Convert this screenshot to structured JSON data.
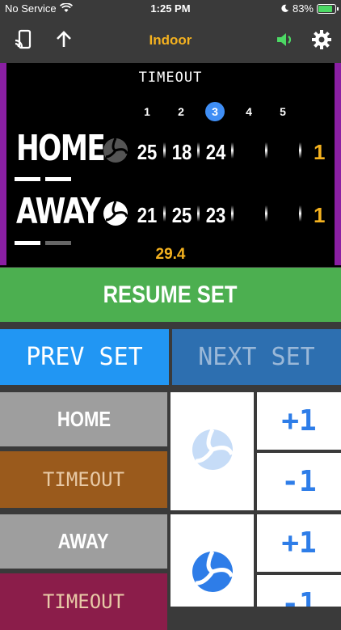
{
  "status": {
    "carrier": "No Service",
    "time": "1:25 PM",
    "battery": "83%"
  },
  "nav": {
    "title": "Indoor"
  },
  "board": {
    "timeout_label": "TIMEOUT",
    "set_numbers": [
      "1",
      "2",
      "3",
      "4",
      "5"
    ],
    "active_set": "3",
    "home": {
      "name": "HOME",
      "scores": [
        "25",
        "18",
        "24"
      ],
      "sets_won": "1"
    },
    "away": {
      "name": "AWAY",
      "scores": [
        "21",
        "25",
        "23"
      ],
      "sets_won": "1"
    },
    "clock": "29.4"
  },
  "controls": {
    "resume": "RESUME SET",
    "prev": "PREV SET",
    "next": "NEXT SET",
    "home_label": "HOME",
    "away_label": "AWAY",
    "timeout": "TIMEOUT",
    "plus": "+1",
    "minus": "-1"
  },
  "colors": {
    "accent": "#f5b21f",
    "resume": "#4caf50",
    "prev": "#2196f3",
    "next": "#2d6fb0",
    "home_timeout": "#9a5a1c",
    "away_timeout": "#8b1d4a",
    "edge": "#8a1fa3"
  }
}
